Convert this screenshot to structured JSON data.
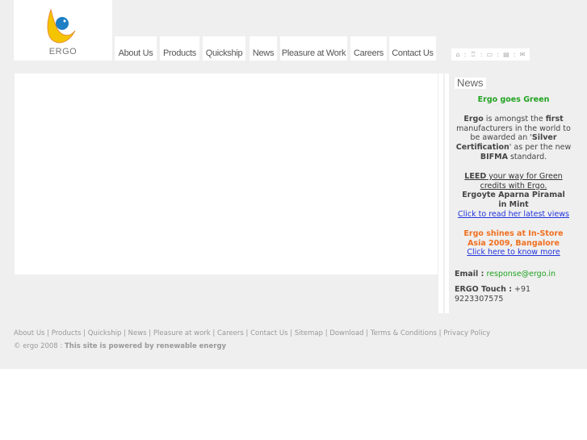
{
  "logo": {
    "text": "ERGO"
  },
  "nav": [
    "About Us",
    "Products",
    "Quickship",
    "News",
    "Pleasure at Work",
    "Careers",
    "Contact Us"
  ],
  "utility_icons": [
    "home-icon",
    "sitemap-icon",
    "download-icon",
    "print-icon",
    "mail-icon"
  ],
  "news": {
    "label": "News",
    "headline1": "Ergo goes Green",
    "p1": {
      "b1": "Ergo",
      "t1": " is amongst the ",
      "b2": "first",
      "t2": " manufacturers in the world to be awarded an '",
      "b3": "Silver Certification",
      "t3": "' as per the new ",
      "b4": "BIFMA",
      "t4": " standard."
    },
    "leed_bold": "LEED",
    "leed_rest": " your way for Green credits with Ergo.",
    "headline2": "Ergoyte Aparna Piramal in Mint",
    "link2": "Click to read her latest views",
    "headline3": "Ergo shines at In-Store Asia 2009, Bangalore",
    "link3": "Click here to know more"
  },
  "contact": {
    "email_label": "Email :",
    "email": "response@ergo.in",
    "touch_label": "ERGO Touch :",
    "touch": "+91 9223307575"
  },
  "footer": {
    "links": [
      "About Us",
      "Products",
      "Quickship",
      "News",
      "Pleasure at work",
      "Careers",
      "Contact Us",
      "Sitemap",
      "Download",
      "Terms & Conditions",
      "Privacy Policy"
    ],
    "copyright": "© ergo 2008 : ",
    "tagline": "This site is powered by renewable energy"
  },
  "colors": {
    "green": "#22a322",
    "orange": "#f07020",
    "link": "#2233dd"
  }
}
